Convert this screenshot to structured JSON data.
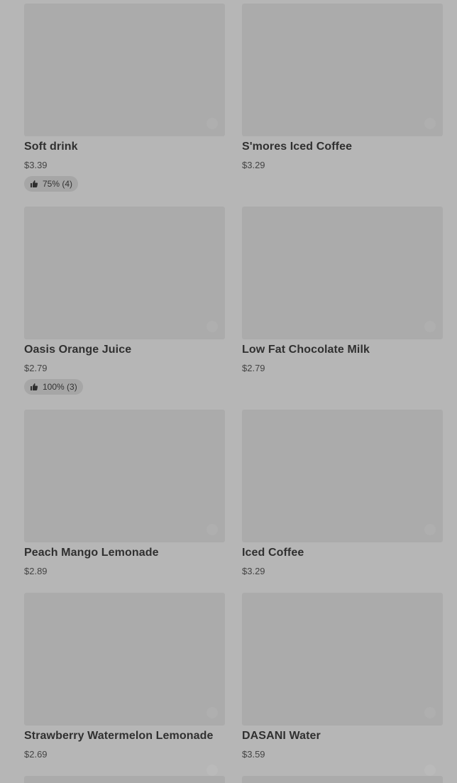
{
  "items": [
    {
      "name": "Soft drink",
      "price": "$3.39",
      "rating": "75% (4)"
    },
    {
      "name": "S'mores Iced Coffee",
      "price": "$3.29"
    },
    {
      "name": "Oasis Orange Juice",
      "price": "$2.79",
      "rating": "100% (3)"
    },
    {
      "name": "Low Fat Chocolate Milk",
      "price": "$2.79"
    },
    {
      "name": "Peach Mango Lemonade",
      "price": "$2.89"
    },
    {
      "name": "Iced Coffee",
      "price": "$3.29"
    },
    {
      "name": "Strawberry Watermelon Lemonade",
      "price": "$2.69"
    },
    {
      "name": "DASANI Water",
      "price": "$3.59"
    }
  ],
  "icons": {
    "rating": "thumbs-up-icon"
  },
  "colors": {
    "background": "#b6b6b6",
    "image_placeholder": "#ababab",
    "rating_pill": "#a6a6a6"
  }
}
